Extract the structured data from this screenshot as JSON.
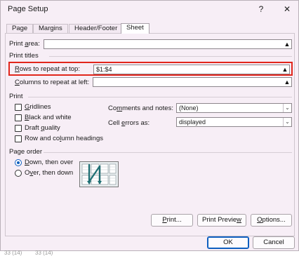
{
  "window": {
    "title": "Page Setup",
    "help_icon": "?",
    "close_icon": "✕"
  },
  "tabs": [
    {
      "label": "Page",
      "active": false
    },
    {
      "label": "Margins",
      "active": false
    },
    {
      "label": "Header/Footer",
      "active": false
    },
    {
      "label": "Sheet",
      "active": true
    }
  ],
  "print_area": {
    "label_pre": "Print ",
    "label_u": "a",
    "label_post": "rea:",
    "value": ""
  },
  "print_titles": {
    "heading": "Print titles",
    "rows": {
      "label_u": "R",
      "label_post": "ows to repeat at top:",
      "value": "$1:$4"
    },
    "columns": {
      "label_u": "C",
      "label_post": "olumns to repeat at left:",
      "value": ""
    }
  },
  "print": {
    "heading": "Print",
    "gridlines": {
      "label_u": "G",
      "label_post": "ridlines",
      "checked": false
    },
    "black_white": {
      "label_u": "B",
      "label_post": "lack and white",
      "checked": false
    },
    "draft": {
      "label_pre": "Draft ",
      "label_u": "q",
      "label_post": "uality",
      "checked": false
    },
    "headings": {
      "label_pre": "Row and co",
      "label_u": "l",
      "label_post": "umn headings",
      "checked": false
    },
    "comments": {
      "label_pre": "Co",
      "label_u": "m",
      "label_post": "ments and notes:",
      "value": "(None)"
    },
    "errors": {
      "label_pre": "Cell ",
      "label_u": "e",
      "label_post": "rrors as:",
      "value": "displayed"
    }
  },
  "page_order": {
    "heading": "Page order",
    "down_over": {
      "label_u": "D",
      "label_post": "own, then over",
      "checked": true
    },
    "over_down": {
      "label_pre": "O",
      "label_u": "v",
      "label_post": "er, then down",
      "checked": false
    }
  },
  "buttons": {
    "print": {
      "label_u": "P",
      "label_post": "rint..."
    },
    "preview": {
      "label_pre": "Print Previe",
      "label_u": "w",
      "label_post": ""
    },
    "options": {
      "label_u": "O",
      "label_post": "ptions..."
    },
    "ok": "OK",
    "cancel": "Cancel"
  },
  "behind": [
    "33 (14)",
    "33 (14)"
  ],
  "colors": {
    "accent": "#0f5fbf",
    "highlight": "#e1261c",
    "dialog_bg": "#f7eef6"
  }
}
